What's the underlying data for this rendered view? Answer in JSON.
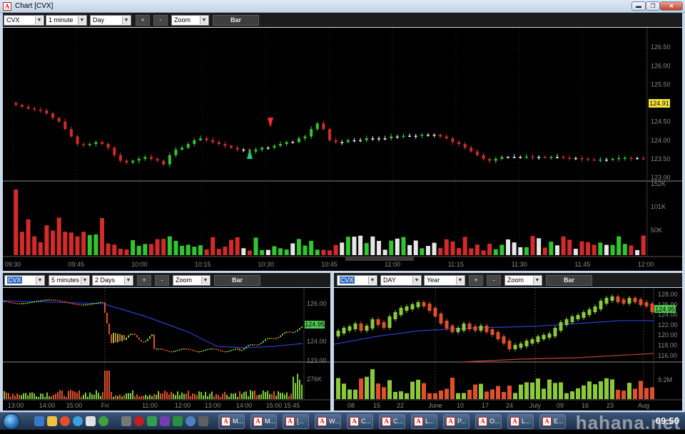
{
  "window": {
    "title": "Chart [CVX]",
    "app_icon_letter": "A",
    "controls": [
      "▬",
      "❐",
      "✕"
    ]
  },
  "main": {
    "toolbar": {
      "symbol": "CVX",
      "interval": "1 minute",
      "range": "Day",
      "zoom_in": "+",
      "zoom_out": "-",
      "zoom": "Zoom",
      "style": "Bar"
    },
    "price_axis": [
      "126.50",
      "126.00",
      "125.50",
      "125.00",
      "124.50",
      "124.00",
      "123.50",
      "123.00"
    ],
    "last_price": "124.91",
    "volume_axis": [
      "152K",
      "101K",
      "50K"
    ],
    "time_axis": [
      "09:30",
      "09:45",
      "10:00",
      "10:15",
      "10:30",
      "10:45",
      "11:00",
      "11:15",
      "11:30",
      "11:45",
      "12:00"
    ],
    "signals": [
      {
        "type": "buy",
        "time": "10:25"
      },
      {
        "type": "sell",
        "time": "10:31"
      }
    ],
    "colors": {
      "up": "#2fc62f",
      "down": "#d42a2a",
      "neutral": "#e6e6e6",
      "buy_arrow": "#19d27a",
      "sell_arrow": "#ff2a2a"
    },
    "chart_data": {
      "type": "candlestick",
      "ylim": [
        123.0,
        126.6
      ],
      "ohlc_close": [
        124.95,
        124.9,
        124.85,
        124.82,
        124.8,
        124.72,
        124.6,
        124.5,
        124.3,
        124.1,
        123.9,
        123.88,
        123.9,
        123.95,
        123.9,
        123.8,
        123.6,
        123.45,
        123.4,
        123.45,
        123.5,
        123.55,
        123.5,
        123.45,
        123.35,
        123.6,
        123.75,
        123.8,
        123.9,
        124.0,
        124.05,
        124.0,
        123.95,
        123.9,
        123.85,
        123.8,
        123.75,
        123.75,
        123.7,
        123.75,
        123.8,
        123.8,
        123.85,
        123.9,
        123.95,
        123.95,
        124.05,
        124.1,
        124.3,
        124.45,
        124.3,
        124.0,
        123.95,
        123.95,
        124.0,
        124.0,
        124.0,
        124.05,
        124.05,
        124.05,
        124.05,
        124.1,
        124.1,
        124.12,
        124.12,
        124.12,
        124.15,
        124.15,
        124.15,
        124.1,
        124.05,
        123.95,
        123.9,
        123.8,
        123.7,
        123.6,
        123.5,
        123.45,
        123.5,
        123.55,
        123.55,
        123.55,
        123.55,
        123.56,
        123.55,
        123.55,
        123.54,
        123.55,
        123.55,
        123.53,
        123.52,
        123.52,
        123.5,
        123.48,
        123.47,
        123.48,
        123.48,
        123.5,
        123.52,
        123.53,
        123.52,
        123.52,
        123.51
      ]
    }
  },
  "left": {
    "toolbar": {
      "symbol": "CVX",
      "interval": "5 minutes",
      "range": "2 Days",
      "zoom_in": "+",
      "zoom_out": "-",
      "zoom": "Zoom",
      "style": "Bar"
    },
    "price_axis": [
      "126.00",
      "124.00",
      "123.00"
    ],
    "last_price": "124.95",
    "volume_axis": [
      "276K"
    ],
    "time_axis": [
      "13:00",
      "14:00",
      "15:00",
      "Fri",
      "11:00",
      "12:00",
      "13:00",
      "14:00",
      "15:00",
      "15:45"
    ]
  },
  "right": {
    "toolbar": {
      "symbol": "CVX",
      "interval": "DAY",
      "range": "Year",
      "zoom_in": "+",
      "zoom_out": "-",
      "zoom": "Zoom",
      "style": "Bar"
    },
    "price_axis": [
      "128.00",
      "126.00",
      "124.00",
      "122.00",
      "120.00",
      "118.00",
      "116.00"
    ],
    "last_price": "124.95",
    "volume_axis": [
      "9.2M"
    ],
    "time_axis": [
      "08",
      "15",
      "22",
      "June",
      "10",
      "17",
      "24",
      "July",
      "09",
      "16",
      "23",
      "Aug"
    ]
  },
  "taskbar": {
    "tasks": [
      "M...",
      "M...",
      "[...",
      "W...",
      "C...",
      "C...",
      "L...",
      "P...",
      "O...",
      "L...",
      "E..."
    ],
    "clock": "09:50"
  },
  "watermark": "hahana.net"
}
